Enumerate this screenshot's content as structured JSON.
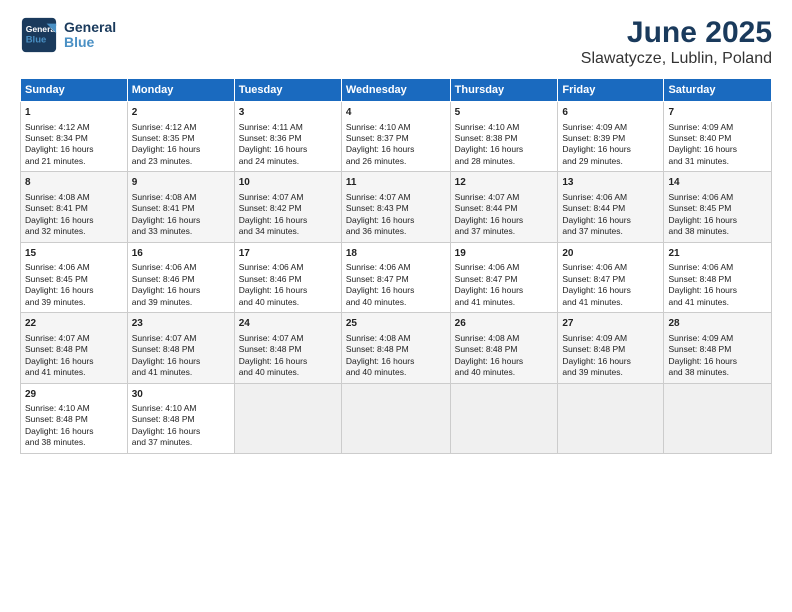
{
  "logo": {
    "line1": "General",
    "line2": "Blue"
  },
  "title": "June 2025",
  "subtitle": "Slawatycze, Lublin, Poland",
  "days_of_week": [
    "Sunday",
    "Monday",
    "Tuesday",
    "Wednesday",
    "Thursday",
    "Friday",
    "Saturday"
  ],
  "weeks": [
    [
      {
        "day": 1,
        "lines": [
          "Sunrise: 4:12 AM",
          "Sunset: 8:34 PM",
          "Daylight: 16 hours",
          "and 21 minutes."
        ]
      },
      {
        "day": 2,
        "lines": [
          "Sunrise: 4:12 AM",
          "Sunset: 8:35 PM",
          "Daylight: 16 hours",
          "and 23 minutes."
        ]
      },
      {
        "day": 3,
        "lines": [
          "Sunrise: 4:11 AM",
          "Sunset: 8:36 PM",
          "Daylight: 16 hours",
          "and 24 minutes."
        ]
      },
      {
        "day": 4,
        "lines": [
          "Sunrise: 4:10 AM",
          "Sunset: 8:37 PM",
          "Daylight: 16 hours",
          "and 26 minutes."
        ]
      },
      {
        "day": 5,
        "lines": [
          "Sunrise: 4:10 AM",
          "Sunset: 8:38 PM",
          "Daylight: 16 hours",
          "and 28 minutes."
        ]
      },
      {
        "day": 6,
        "lines": [
          "Sunrise: 4:09 AM",
          "Sunset: 8:39 PM",
          "Daylight: 16 hours",
          "and 29 minutes."
        ]
      },
      {
        "day": 7,
        "lines": [
          "Sunrise: 4:09 AM",
          "Sunset: 8:40 PM",
          "Daylight: 16 hours",
          "and 31 minutes."
        ]
      }
    ],
    [
      {
        "day": 8,
        "lines": [
          "Sunrise: 4:08 AM",
          "Sunset: 8:41 PM",
          "Daylight: 16 hours",
          "and 32 minutes."
        ]
      },
      {
        "day": 9,
        "lines": [
          "Sunrise: 4:08 AM",
          "Sunset: 8:41 PM",
          "Daylight: 16 hours",
          "and 33 minutes."
        ]
      },
      {
        "day": 10,
        "lines": [
          "Sunrise: 4:07 AM",
          "Sunset: 8:42 PM",
          "Daylight: 16 hours",
          "and 34 minutes."
        ]
      },
      {
        "day": 11,
        "lines": [
          "Sunrise: 4:07 AM",
          "Sunset: 8:43 PM",
          "Daylight: 16 hours",
          "and 36 minutes."
        ]
      },
      {
        "day": 12,
        "lines": [
          "Sunrise: 4:07 AM",
          "Sunset: 8:44 PM",
          "Daylight: 16 hours",
          "and 37 minutes."
        ]
      },
      {
        "day": 13,
        "lines": [
          "Sunrise: 4:06 AM",
          "Sunset: 8:44 PM",
          "Daylight: 16 hours",
          "and 37 minutes."
        ]
      },
      {
        "day": 14,
        "lines": [
          "Sunrise: 4:06 AM",
          "Sunset: 8:45 PM",
          "Daylight: 16 hours",
          "and 38 minutes."
        ]
      }
    ],
    [
      {
        "day": 15,
        "lines": [
          "Sunrise: 4:06 AM",
          "Sunset: 8:45 PM",
          "Daylight: 16 hours",
          "and 39 minutes."
        ]
      },
      {
        "day": 16,
        "lines": [
          "Sunrise: 4:06 AM",
          "Sunset: 8:46 PM",
          "Daylight: 16 hours",
          "and 39 minutes."
        ]
      },
      {
        "day": 17,
        "lines": [
          "Sunrise: 4:06 AM",
          "Sunset: 8:46 PM",
          "Daylight: 16 hours",
          "and 40 minutes."
        ]
      },
      {
        "day": 18,
        "lines": [
          "Sunrise: 4:06 AM",
          "Sunset: 8:47 PM",
          "Daylight: 16 hours",
          "and 40 minutes."
        ]
      },
      {
        "day": 19,
        "lines": [
          "Sunrise: 4:06 AM",
          "Sunset: 8:47 PM",
          "Daylight: 16 hours",
          "and 41 minutes."
        ]
      },
      {
        "day": 20,
        "lines": [
          "Sunrise: 4:06 AM",
          "Sunset: 8:47 PM",
          "Daylight: 16 hours",
          "and 41 minutes."
        ]
      },
      {
        "day": 21,
        "lines": [
          "Sunrise: 4:06 AM",
          "Sunset: 8:48 PM",
          "Daylight: 16 hours",
          "and 41 minutes."
        ]
      }
    ],
    [
      {
        "day": 22,
        "lines": [
          "Sunrise: 4:07 AM",
          "Sunset: 8:48 PM",
          "Daylight: 16 hours",
          "and 41 minutes."
        ]
      },
      {
        "day": 23,
        "lines": [
          "Sunrise: 4:07 AM",
          "Sunset: 8:48 PM",
          "Daylight: 16 hours",
          "and 41 minutes."
        ]
      },
      {
        "day": 24,
        "lines": [
          "Sunrise: 4:07 AM",
          "Sunset: 8:48 PM",
          "Daylight: 16 hours",
          "and 40 minutes."
        ]
      },
      {
        "day": 25,
        "lines": [
          "Sunrise: 4:08 AM",
          "Sunset: 8:48 PM",
          "Daylight: 16 hours",
          "and 40 minutes."
        ]
      },
      {
        "day": 26,
        "lines": [
          "Sunrise: 4:08 AM",
          "Sunset: 8:48 PM",
          "Daylight: 16 hours",
          "and 40 minutes."
        ]
      },
      {
        "day": 27,
        "lines": [
          "Sunrise: 4:09 AM",
          "Sunset: 8:48 PM",
          "Daylight: 16 hours",
          "and 39 minutes."
        ]
      },
      {
        "day": 28,
        "lines": [
          "Sunrise: 4:09 AM",
          "Sunset: 8:48 PM",
          "Daylight: 16 hours",
          "and 38 minutes."
        ]
      }
    ],
    [
      {
        "day": 29,
        "lines": [
          "Sunrise: 4:10 AM",
          "Sunset: 8:48 PM",
          "Daylight: 16 hours",
          "and 38 minutes."
        ]
      },
      {
        "day": 30,
        "lines": [
          "Sunrise: 4:10 AM",
          "Sunset: 8:48 PM",
          "Daylight: 16 hours",
          "and 37 minutes."
        ]
      },
      null,
      null,
      null,
      null,
      null
    ]
  ]
}
